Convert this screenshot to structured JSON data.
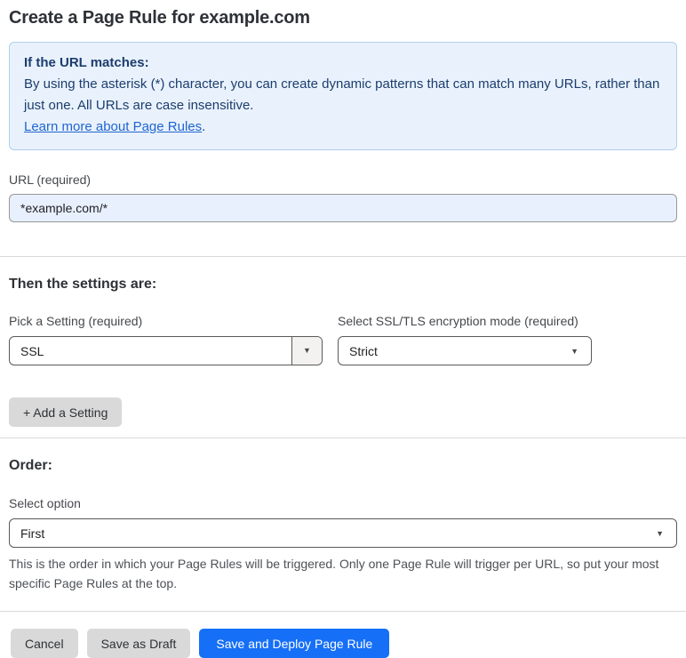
{
  "page": {
    "title": "Create a Page Rule for example.com"
  },
  "info_box": {
    "heading": "If the URL matches:",
    "body": "By using the asterisk (*) character, you can create dynamic patterns that can match many URLs, rather than just one. All URLs are case insensitive.",
    "link_label": "Learn more about Page Rules",
    "link_suffix": "."
  },
  "url_field": {
    "label": "URL (required)",
    "value": "*example.com/*"
  },
  "settings_section": {
    "heading": "Then the settings are:",
    "setting_picker": {
      "label": "Pick a Setting (required)",
      "value": "SSL"
    },
    "mode_picker": {
      "label": "Select SSL/TLS encryption mode (required)",
      "value": "Strict"
    },
    "add_setting_label": "+ Add a Setting"
  },
  "order_section": {
    "heading": "Order:",
    "select_label": "Select option",
    "value": "First",
    "help_text": "This is the order in which your Page Rules will be triggered. Only one Page Rule will trigger per URL, so put your most specific Page Rules at the top."
  },
  "actions": {
    "cancel": "Cancel",
    "save_draft": "Save as Draft",
    "save_deploy": "Save and Deploy Page Rule"
  },
  "icons": {
    "dropdown_arrow": "▼"
  },
  "colors": {
    "accent_blue": "#156ff7",
    "info_background": "#e9f2fc",
    "info_border": "#aecfee",
    "info_text": "#1c3d6e",
    "link_blue": "#2065d1",
    "input_autofill_blue": "#e8f0fe",
    "gray_button": "#d9d9d9",
    "divider": "#d9d9d9"
  }
}
